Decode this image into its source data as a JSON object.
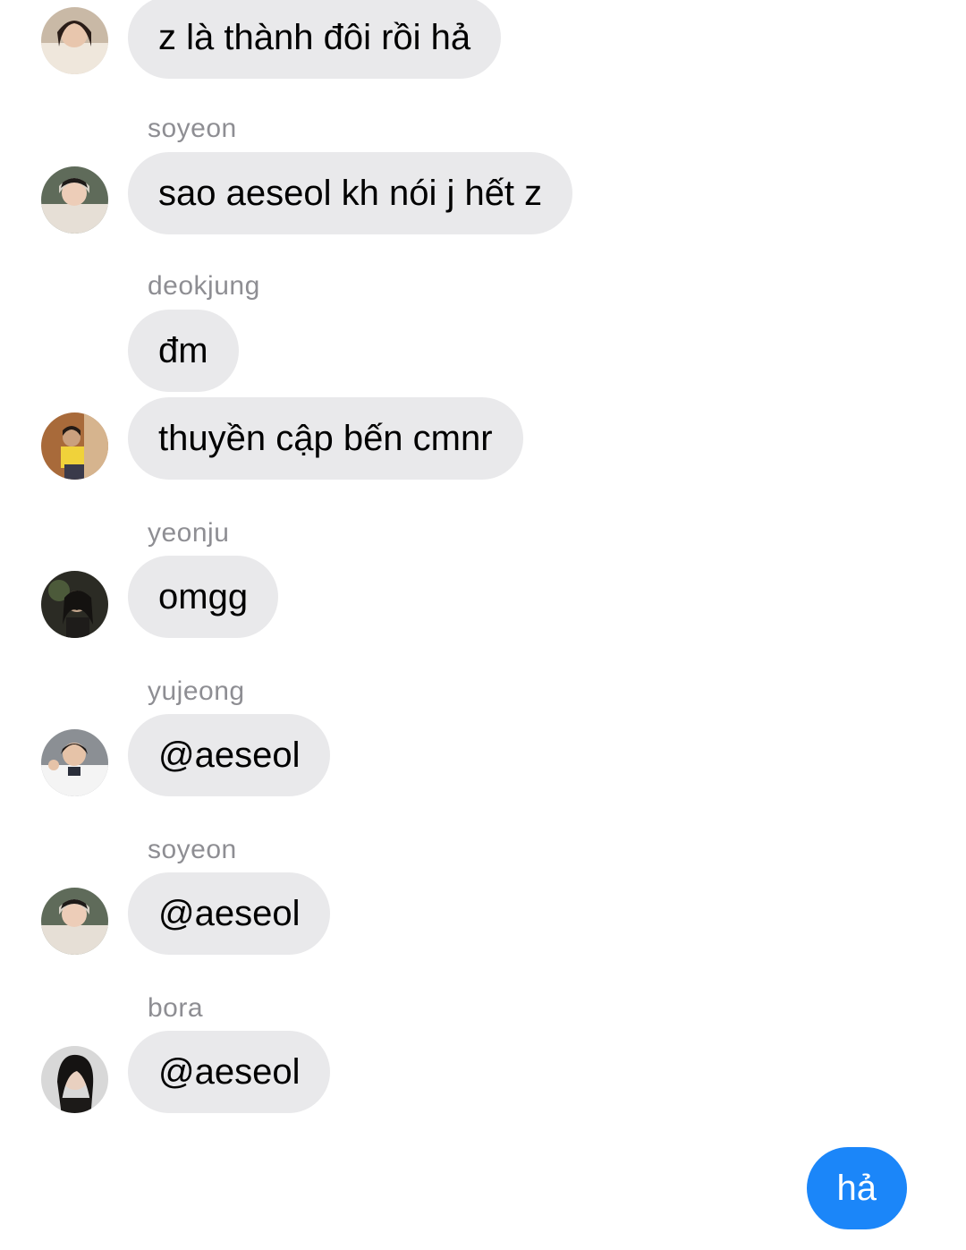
{
  "conversation": {
    "messages": [
      {
        "sender": "",
        "text": "z là thành đôi rồi hả"
      },
      {
        "sender": "soyeon",
        "text": "sao aeseol kh nói j hết z"
      },
      {
        "sender": "deokjung",
        "text": "đm"
      },
      {
        "sender": "",
        "text": "thuyền cập bến cmnr"
      },
      {
        "sender": "yeonju",
        "text": "omgg"
      },
      {
        "sender": "yujeong",
        "text": "@aeseol"
      },
      {
        "sender": "soyeon",
        "text": "@aeseol"
      },
      {
        "sender": "bora",
        "text": "@aeseol"
      }
    ],
    "outgoing": {
      "text": "hả"
    }
  },
  "colors": {
    "incoming_bubble": "#e9e9eb",
    "outgoing_bubble": "#1b86f9",
    "sender_label": "#8e8e93",
    "background": "#ffffff"
  },
  "icons": [
    "avatar-photo"
  ]
}
